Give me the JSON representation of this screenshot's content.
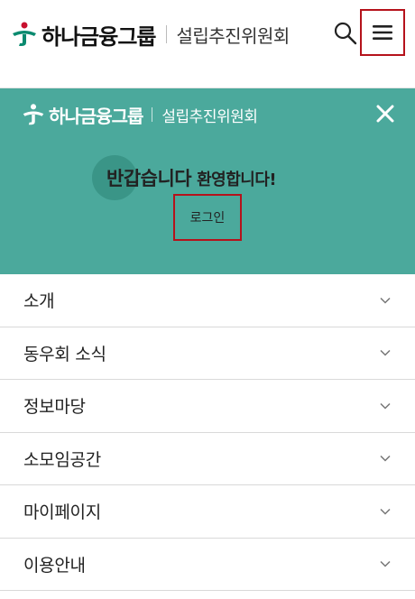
{
  "header": {
    "logo_main": "하나금융그룹",
    "logo_sub": "설립추진위원회",
    "icons": {
      "search": "search-icon",
      "menu": "hamburger-menu-icon"
    }
  },
  "panel": {
    "logo_main": "하나금융그룹",
    "logo_sub": "설립추진위원회",
    "welcome_strong": "반갑습니다",
    "welcome_rest": "환영합니다!",
    "login_label": "로그인",
    "close_icon": "close-icon"
  },
  "menu": {
    "items": [
      {
        "label": "소개"
      },
      {
        "label": "동우회 소식"
      },
      {
        "label": "정보마당"
      },
      {
        "label": "소모임공간"
      },
      {
        "label": "마이페이지"
      },
      {
        "label": "이용안내"
      }
    ]
  },
  "colors": {
    "brand_green": "#0a8a6f",
    "brand_red": "#c8102e",
    "panel_teal": "#4ba99c",
    "highlight_border": "#b5121b"
  }
}
